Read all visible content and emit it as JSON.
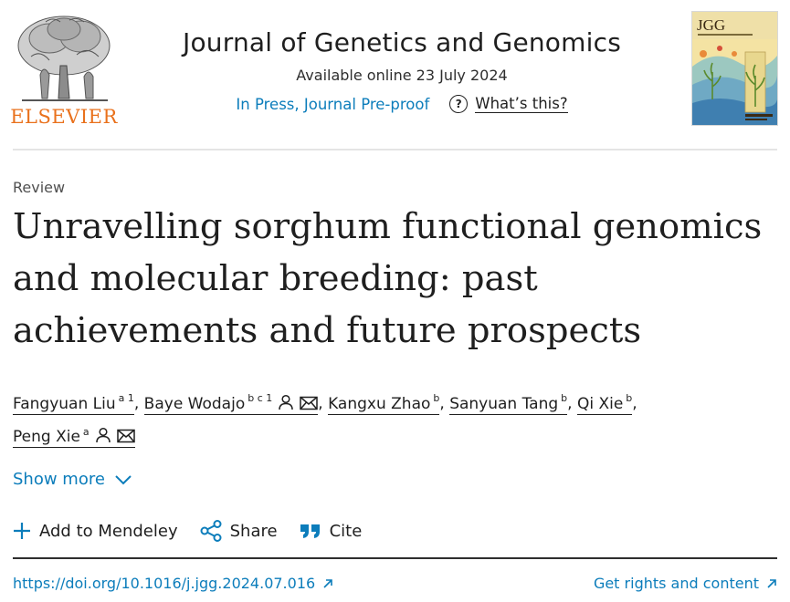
{
  "header": {
    "publisher": "ELSEVIER",
    "journal_title": "Journal of Genetics and Genomics",
    "available_online": "Available online 23 July 2024",
    "status": "In Press, Journal Pre-proof",
    "whats_this": "What’s this?",
    "cover_title": "JGG"
  },
  "article": {
    "type": "Review",
    "title": "Unravelling sorghum functional genomics and molecular breeding: past achievements and future prospects",
    "authors": [
      {
        "name": "Fangyuan Liu",
        "sup": "a 1",
        "sep": ", "
      },
      {
        "name": "Baye Wodajo",
        "sup": "b c 1",
        "sep": ", "
      },
      {
        "name": "Kangxu Zhao",
        "sup": "b",
        "sep": ", "
      },
      {
        "name": "Sanyuan Tang",
        "sup": "b",
        "sep": ", "
      },
      {
        "name": "Qi Xie",
        "sup": "b",
        "sep": ","
      },
      {
        "name": "Peng Xie",
        "sup": "a",
        "sep": ""
      }
    ],
    "show_more": "Show more"
  },
  "actions": {
    "add_to_mendeley": "Add to Mendeley",
    "share": "Share",
    "cite": "Cite"
  },
  "footer": {
    "doi": "https://doi.org/10.1016/j.jgg.2024.07.016",
    "rights": "Get rights and content"
  },
  "colors": {
    "link": "#0c7dbb",
    "publisher_orange": "#e9711c",
    "text": "#1f1f1f"
  },
  "icons": [
    "elsevier-tree-logo",
    "question-icon",
    "person-icon",
    "envelope-icon",
    "chevron-down-icon",
    "plus-icon",
    "share-icon",
    "quote-icon",
    "external-arrow-icon"
  ]
}
